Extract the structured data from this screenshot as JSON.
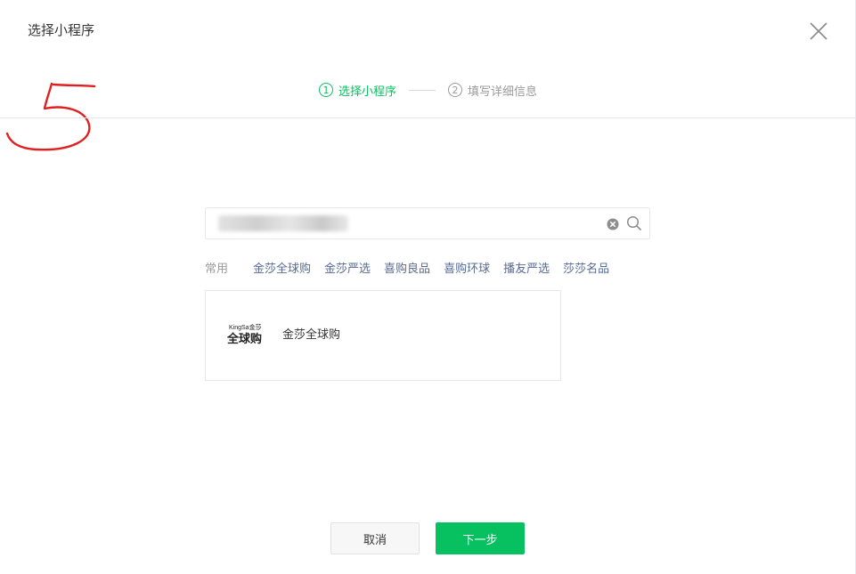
{
  "dialog": {
    "title": "选择小程序",
    "close_icon": "close-icon"
  },
  "steps": [
    {
      "number": "1",
      "label": "选择小程序",
      "state": "active"
    },
    {
      "number": "2",
      "label": "填写详细信息",
      "state": "inactive"
    }
  ],
  "search": {
    "value": "",
    "placeholder": "",
    "clear_icon": "clear-circle-icon",
    "search_icon": "search-icon"
  },
  "common": {
    "label": "常用",
    "items": [
      "金莎全球购",
      "金莎严选",
      "喜购良品",
      "喜购环球",
      "播友严选",
      "莎莎名品"
    ]
  },
  "result": {
    "logo_top": "KingSa金莎",
    "logo_bottom": "全球购",
    "name": "金莎全球购"
  },
  "footer": {
    "cancel_label": "取消",
    "next_label": "下一步"
  },
  "colors": {
    "accent": "#07c160",
    "link": "#576b95",
    "muted": "#9a9a9a",
    "annotation": "#e02020"
  }
}
